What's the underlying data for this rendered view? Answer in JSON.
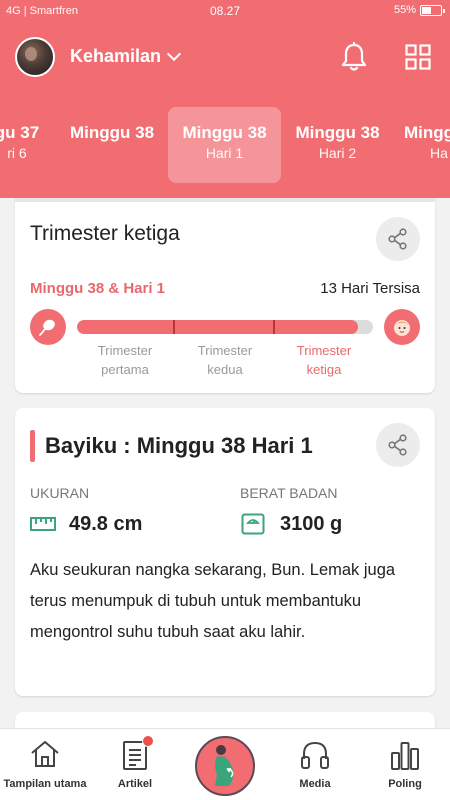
{
  "status": {
    "carrier": "4G | Smartfren",
    "time": "08.27",
    "battery": "55%",
    "battery_level": 0.55
  },
  "header": {
    "title": "Kehamilan"
  },
  "weeks": [
    {
      "week": "gu 37",
      "day": "ri 6"
    },
    {
      "week": "Minggu 38",
      "day": ""
    },
    {
      "week": "Minggu 38",
      "day": "Hari 1",
      "selected": true
    },
    {
      "week": "Minggu 38",
      "day": "Hari 2"
    },
    {
      "week": "Mingg",
      "day": "Ha"
    }
  ],
  "trimester": {
    "title": "Trimester ketiga",
    "week_label": "Minggu 38 & Hari 1",
    "remaining": "13 Hari Tersisa",
    "progress": 0.95,
    "stages": [
      {
        "line1": "Trimester",
        "line2": "pertama"
      },
      {
        "line1": "Trimester",
        "line2": "kedua"
      },
      {
        "line1": "Trimester",
        "line2": "ketiga",
        "active": true
      }
    ]
  },
  "baby": {
    "title": "Bayiku : Minggu 38 Hari 1",
    "size_label": "UKURAN",
    "size_value": "49.8 cm",
    "weight_label": "BERAT BADAN",
    "weight_value": "3100 g",
    "description": "Aku seukuran nangka sekarang, Bun. Lemak juga terus menumpuk di tubuh untuk membantuku mengontrol suhu tubuh saat aku lahir."
  },
  "nav": {
    "home": "Tampilan utama",
    "article": "Artikel",
    "media": "Media",
    "poll": "Poling"
  },
  "colors": {
    "accent": "#f26d72",
    "accent_dark": "#b8343b",
    "muted": "#9a9a9a"
  }
}
